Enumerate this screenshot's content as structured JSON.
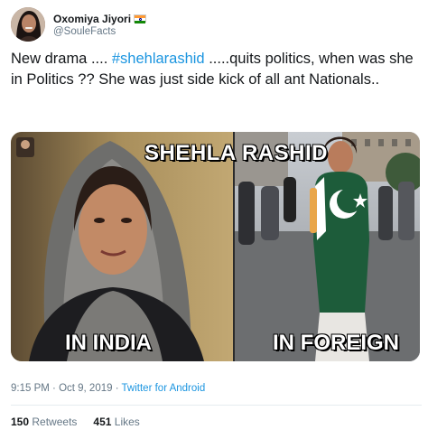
{
  "user": {
    "display_name": "Oxomiya Jiyori",
    "handle": "@SouleFacts",
    "flag_icon": "india-flag-icon"
  },
  "tweet": {
    "text_before": "New drama .... ",
    "hashtag": "#shehlarashid",
    "text_after": " .....quits politics, when was she in Politics ?? She was just side kick of all ant Nationals.."
  },
  "media": {
    "title": "SHEHLA RASHID",
    "left_label": "IN INDIA",
    "right_label": "IN FOREIGN"
  },
  "meta": {
    "time": "9:15 PM",
    "separator": " · ",
    "date": "Oct 9, 2019",
    "dot": " · ",
    "source": "Twitter for Android"
  },
  "stats": {
    "retweets_count": "150",
    "retweets_label": "Retweets",
    "likes_count": "451",
    "likes_label": "Likes"
  },
  "colors": {
    "link": "#1b95e0",
    "secondary": "#657786",
    "text": "#14171a"
  }
}
